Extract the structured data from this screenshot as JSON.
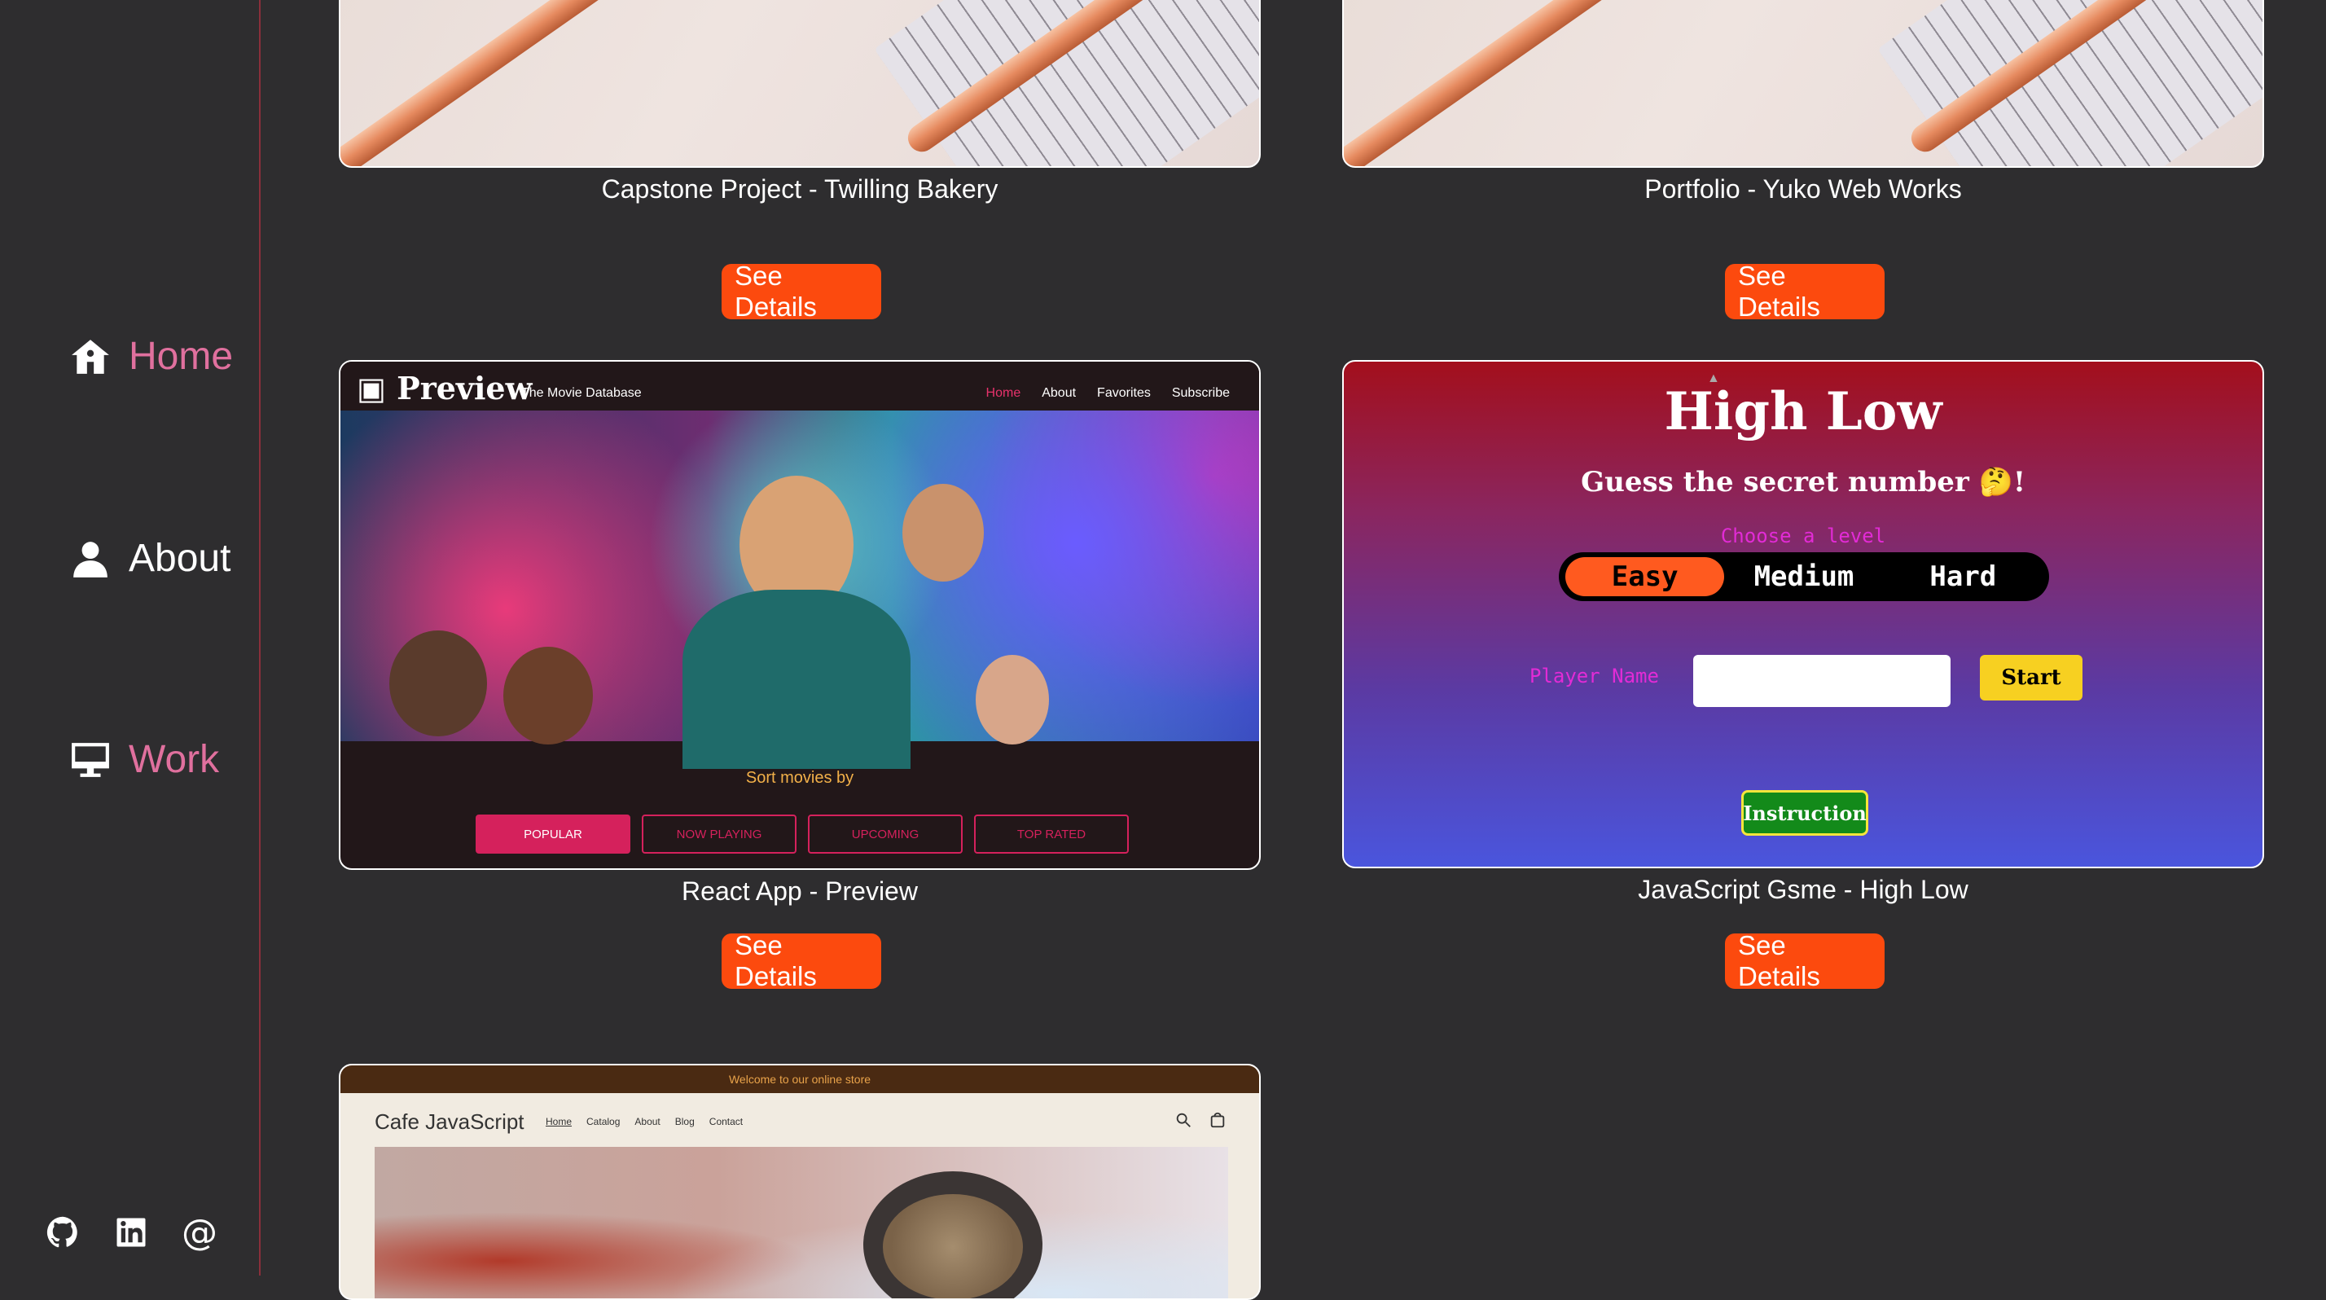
{
  "sidebar": {
    "items": [
      {
        "label": "Home",
        "icon": "house-icon"
      },
      {
        "label": "About",
        "icon": "user-icon"
      },
      {
        "label": "Work",
        "icon": "monitor-icon"
      }
    ],
    "social": [
      {
        "icon": "github-icon"
      },
      {
        "icon": "linkedin-icon"
      },
      {
        "icon": "at-icon",
        "glyph": "@"
      }
    ]
  },
  "projects": [
    {
      "title": "Capstone Project - Twilling Bakery",
      "button": "See Details"
    },
    {
      "title": "Portfolio - Yuko Web Works",
      "button": "See Details"
    },
    {
      "title": "React App - Preview",
      "button": "See Details"
    },
    {
      "title": "JavaScript Gsme - High Low",
      "button": "See Details"
    }
  ],
  "preview_app": {
    "logo": "Preview",
    "subtitle": "The Movie Database",
    "nav": [
      "Home",
      "About",
      "Favorites",
      "Subscribe"
    ],
    "sort_label": "Sort movies by",
    "tabs": [
      "POPULAR",
      "NOW PLAYING",
      "UPCOMING",
      "TOP RATED"
    ]
  },
  "highlow_app": {
    "title": "High Low",
    "subtitle": "Guess the secret number 🤔!",
    "choose": "Choose a level",
    "levels": [
      "Easy",
      "Medium",
      "Hard"
    ],
    "player_label": "Player Name",
    "start": "Start",
    "instruction": "Instruction"
  },
  "cafe_app": {
    "banner": "Welcome to our online store",
    "title": "Cafe JavaScript",
    "nav": [
      "Home",
      "Catalog",
      "About",
      "Blog",
      "Contact"
    ]
  },
  "colors": {
    "accent": "#fc4a0e",
    "nav_active": "#e0709e",
    "background": "#2e2d2f"
  }
}
